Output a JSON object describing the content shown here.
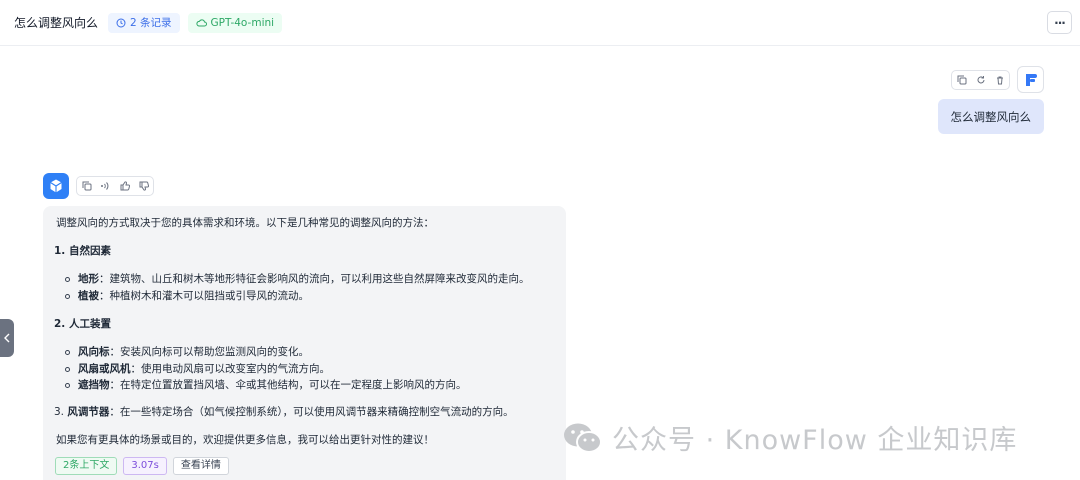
{
  "header": {
    "title": "怎么调整风向么",
    "records_tag": "2 条记录",
    "model_tag": "GPT-4o-mini",
    "more_label": "···"
  },
  "user_message": {
    "text": "怎么调整风向么"
  },
  "assistant_message": {
    "intro": "调整风向的方式取决于您的具体需求和环境。以下是几种常见的调整风向的方法：",
    "sections": [
      {
        "title": "1. 自然因素",
        "items": [
          {
            "term": "地形",
            "desc": "：建筑物、山丘和树木等地形特征会影响风的流向，可以利用这些自然屏障来改变风的走向。"
          },
          {
            "term": "植被",
            "desc": "：种植树木和灌木可以阻挡或引导风的流动。"
          }
        ]
      },
      {
        "title": "2. 人工装置",
        "items": [
          {
            "term": "风向标",
            "desc": "：安装风向标可以帮助您监测风向的变化。"
          },
          {
            "term": "风扇或风机",
            "desc": "：使用电动风扇可以改变室内的气流方向。"
          },
          {
            "term": "遮挡物",
            "desc": "：在特定位置放置挡风墙、伞或其他结构，可以在一定程度上影响风的方向。"
          }
        ]
      }
    ],
    "item3_num": "3.",
    "item3_term": "风调节器",
    "item3_desc": "：在一些特定场合（如气候控制系统），可以使用风调节器来精确控制空气流动的方向。",
    "closing": "如果您有更具体的场景或目的，欢迎提供更多信息，我可以给出更针对性的建议！",
    "chips": {
      "context": "2条上下文",
      "time": "3.07s",
      "details": "查看详情"
    }
  },
  "watermark": {
    "text": "公众号 · KnowFlow 企业知识库"
  },
  "colors": {
    "accent": "#2f80f6",
    "user_bubble": "#dfe6fb",
    "bot_bubble": "#f3f4f6"
  }
}
